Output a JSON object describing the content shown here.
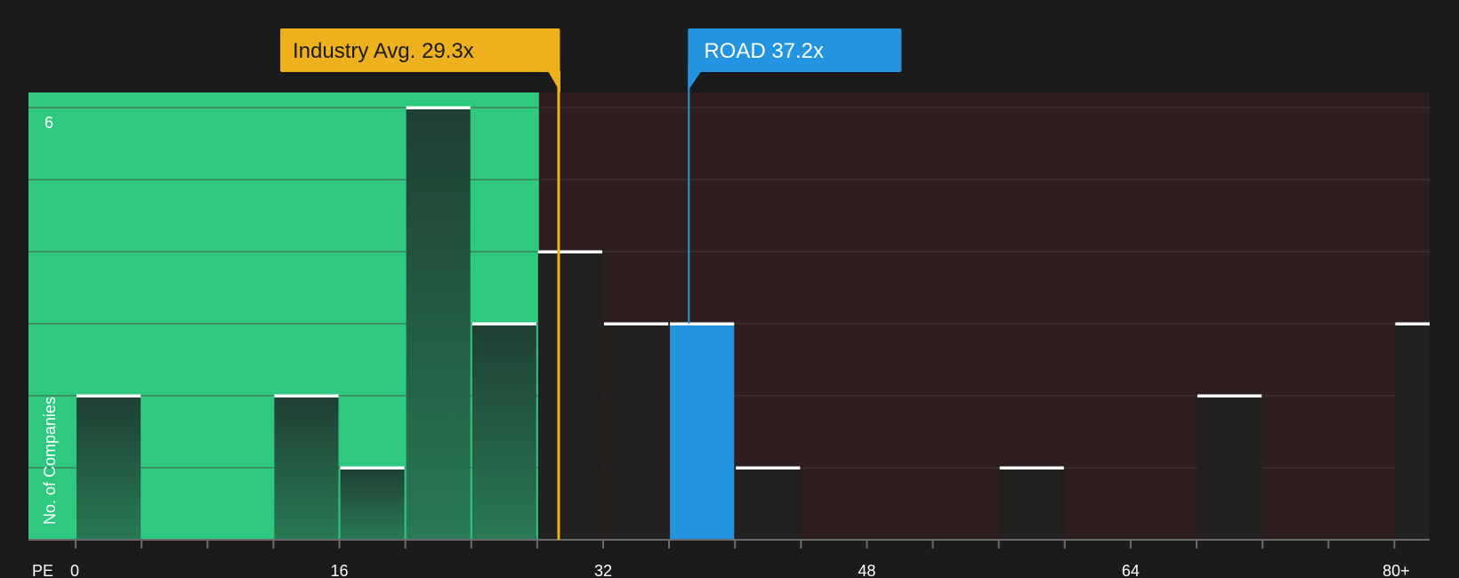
{
  "chart_data": {
    "type": "bar",
    "title": "",
    "xlabel": "PE",
    "ylabel": "No. of Companies",
    "y_max_label": "6",
    "x_ticks": [
      "0",
      "16",
      "32",
      "48",
      "64",
      "80+"
    ],
    "xlim": [
      -3,
      82
    ],
    "ylim": [
      0,
      6.2
    ],
    "bin_width": 4,
    "bins": [
      {
        "start": 0,
        "end": 4,
        "value": 2
      },
      {
        "start": 12,
        "end": 16,
        "value": 2
      },
      {
        "start": 16,
        "end": 20,
        "value": 1
      },
      {
        "start": 20,
        "end": 24,
        "value": 6
      },
      {
        "start": 24,
        "end": 28,
        "value": 3
      },
      {
        "start": 28,
        "end": 32,
        "value": 4
      },
      {
        "start": 32,
        "end": 36,
        "value": 3
      },
      {
        "start": 36,
        "end": 40,
        "value": 3,
        "highlight": true
      },
      {
        "start": 40,
        "end": 44,
        "value": 1
      },
      {
        "start": 56,
        "end": 60,
        "value": 1
      },
      {
        "start": 68,
        "end": 72,
        "value": 2
      },
      {
        "start": 80,
        "end": 84,
        "value": 3
      }
    ],
    "fair_zone_end": 28,
    "industry_avg": {
      "label": "Industry Avg. 29.3x",
      "value": 29.3
    },
    "company": {
      "label": "ROAD 37.2x",
      "value": 37.2
    },
    "colors": {
      "background": "#1b1b1b",
      "green_zone": "#2ec97f",
      "red_zone": "#2e1e1f",
      "bar_in_green": "#22483a",
      "bar_in_red": "#232020",
      "highlight": "#2394e0",
      "industry": "#eeb11e",
      "cap": "#ffffff",
      "grid": "#474040"
    }
  }
}
